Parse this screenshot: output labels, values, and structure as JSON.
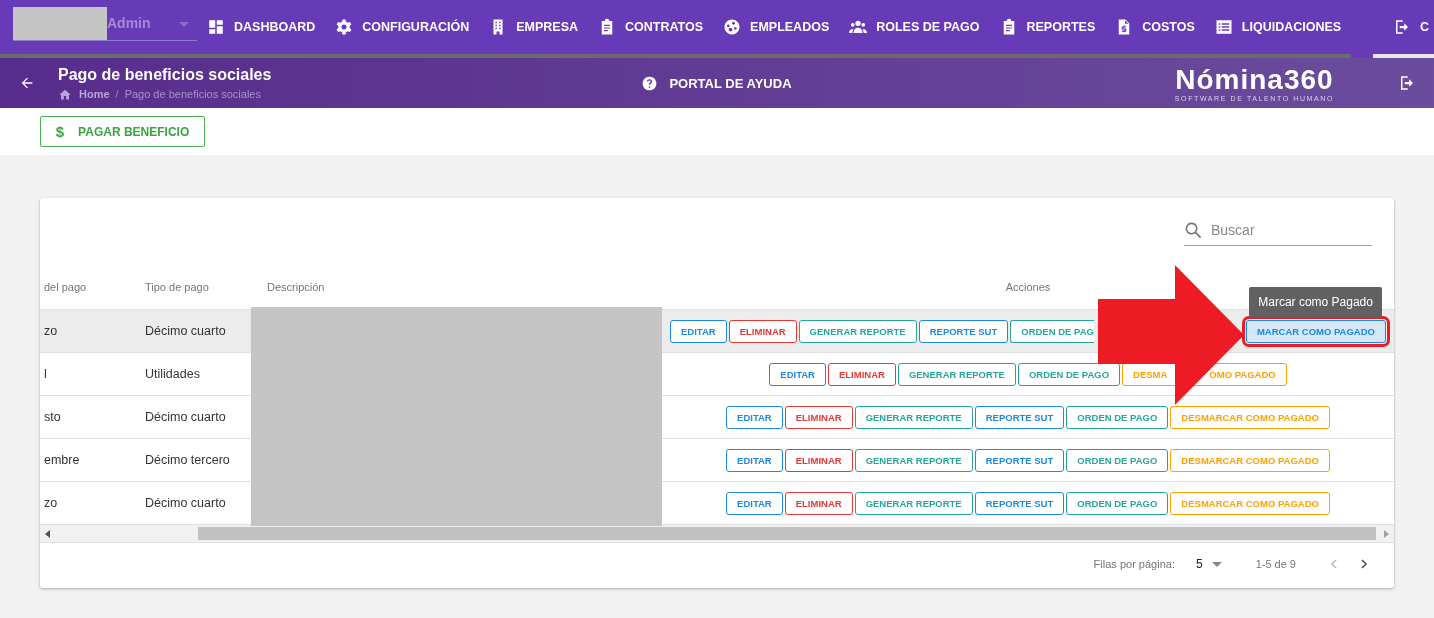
{
  "top_nav": {
    "user": {
      "name": "Admin"
    },
    "items": [
      {
        "label": "DASHBOARD",
        "selected": false
      },
      {
        "label": "CONFIGURACIÓN",
        "selected": false
      },
      {
        "label": "EMPRESA",
        "selected": false
      },
      {
        "label": "CONTRATOS",
        "selected": false
      },
      {
        "label": "EMPLEADOS",
        "selected": false
      },
      {
        "label": "ROLES DE PAGO",
        "selected": false
      },
      {
        "label": "REPORTES",
        "selected": false
      },
      {
        "label": "COSTOS",
        "selected": false
      },
      {
        "label": "LIQUIDACIONES",
        "selected": false
      },
      {
        "label": "C",
        "selected": true
      }
    ]
  },
  "header": {
    "title": "Pago de beneficios sociales",
    "breadcrumb": [
      {
        "label": "Home",
        "kind": "home"
      },
      {
        "label": "Pago de beneficios sociales",
        "kind": "current"
      }
    ],
    "separator": "/",
    "help": "PORTAL DE AYUDA",
    "logo": {
      "name": "Nómina360",
      "tagline": "SOFTWARE DE TALENTO HUMANO"
    }
  },
  "toolbar": {
    "button": {
      "label": "PAGAR BENEFICIO",
      "icon": "$"
    }
  },
  "search": {
    "placeholder": "Buscar"
  },
  "table": {
    "columns": [
      "del pago",
      "Tipo de pago",
      "Descripción",
      "Acciones"
    ],
    "rows": [
      {
        "column_1": "zo",
        "type": "Décimo cuarto",
        "hovered": true,
        "actions": [
          {
            "label": "EDITAR",
            "kind": "edit"
          },
          {
            "label": "ELIMINAR",
            "kind": "delete"
          },
          {
            "label": "GENERAR REPORTE",
            "kind": "report"
          },
          {
            "label": "REPORTE SUT",
            "kind": "sut"
          },
          {
            "label": "ORDEN DE PAG",
            "kind": "order",
            "covered": true
          },
          {
            "label": "MARCAR COMO PAGADO",
            "kind": "mark",
            "hovered": true,
            "highlighted": true,
            "tooltip": "Marcar como Pagado"
          }
        ]
      },
      {
        "column_1": "l",
        "type": "Utilidades",
        "actions": [
          {
            "label": "EDITAR",
            "kind": "edit"
          },
          {
            "label": "ELIMINAR",
            "kind": "delete"
          },
          {
            "label": "GENERAR REPORTE",
            "kind": "report"
          },
          {
            "label": "ORDEN DE PAGO",
            "kind": "order"
          },
          {
            "label": "DESMA",
            "label_tail": "OMO PAGADO",
            "kind": "unmark"
          }
        ]
      },
      {
        "column_1": "sto",
        "type": "Décimo cuarto",
        "actions": [
          {
            "label": "EDITAR",
            "kind": "edit"
          },
          {
            "label": "ELIMINAR",
            "kind": "delete"
          },
          {
            "label": "GENERAR REPORTE",
            "kind": "report"
          },
          {
            "label": "REPORTE SUT",
            "kind": "sut"
          },
          {
            "label": "ORDEN DE PAGO",
            "kind": "order"
          },
          {
            "label": "DESMARCAR COMO PAGADO",
            "kind": "unmark"
          }
        ]
      },
      {
        "column_1": "embre",
        "type": "Décimo tercero",
        "actions": [
          {
            "label": "EDITAR",
            "kind": "edit"
          },
          {
            "label": "ELIMINAR",
            "kind": "delete"
          },
          {
            "label": "GENERAR REPORTE",
            "kind": "report"
          },
          {
            "label": "REPORTE SUT",
            "kind": "sut"
          },
          {
            "label": "ORDEN DE PAGO",
            "kind": "order"
          },
          {
            "label": "DESMARCAR COMO PAGADO",
            "kind": "unmark"
          }
        ]
      },
      {
        "column_1": "zo",
        "type": "Décimo cuarto",
        "actions": [
          {
            "label": "EDITAR",
            "kind": "edit"
          },
          {
            "label": "ELIMINAR",
            "kind": "delete"
          },
          {
            "label": "GENERAR REPORTE",
            "kind": "report"
          },
          {
            "label": "REPORTE SUT",
            "kind": "sut"
          },
          {
            "label": "ORDEN DE PAGO",
            "kind": "order"
          },
          {
            "label": "DESMARCAR COMO PAGADO",
            "kind": "unmark"
          }
        ]
      }
    ]
  },
  "pagination": {
    "label": "Filas por página:",
    "rows_per_page": "5",
    "range": "1-5 de 9",
    "previous": {
      "disabled": true
    },
    "next": {
      "disabled": false
    }
  }
}
